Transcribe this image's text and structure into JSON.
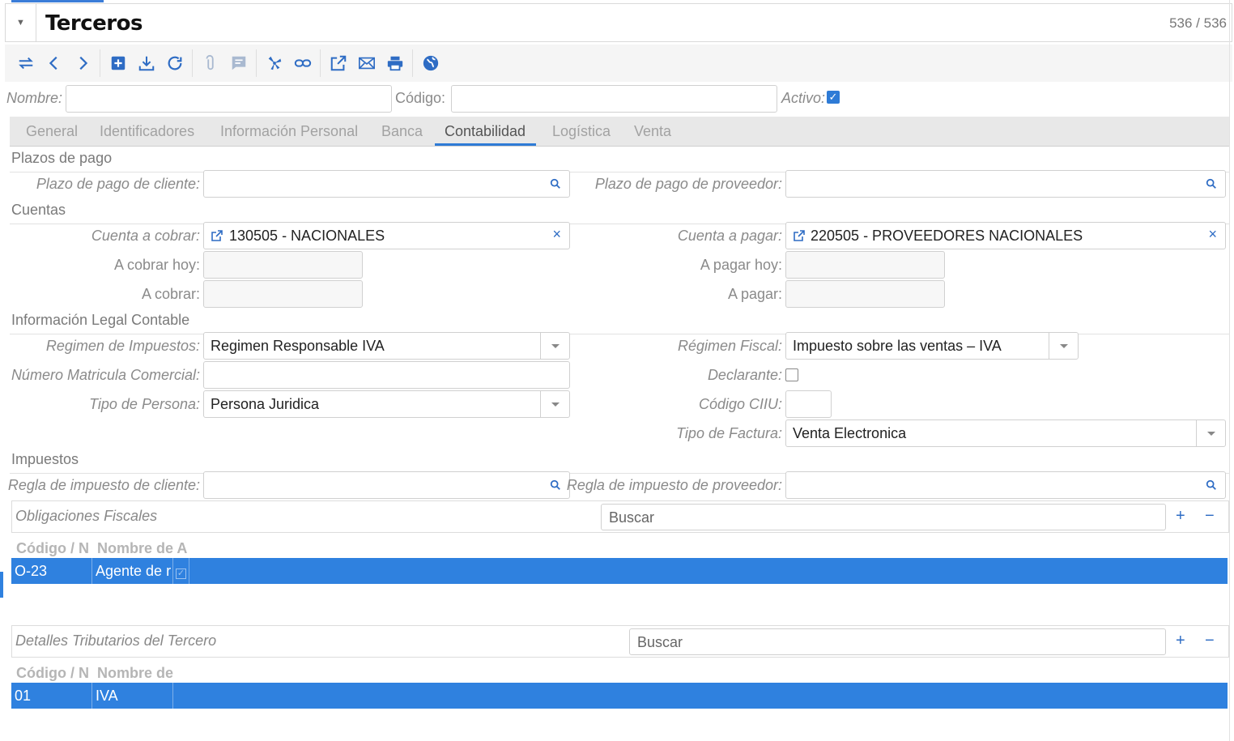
{
  "header": {
    "title": "Terceros",
    "record_count": "536 / 536"
  },
  "toolbar": {
    "icons": [
      "toggle-view-icon",
      "previous-icon",
      "next-icon",
      "new-record-icon",
      "save-icon",
      "reload-icon",
      "attachment-icon",
      "note-icon",
      "action-icon",
      "relate-icon",
      "open-icon",
      "email-icon",
      "print-icon",
      "web-icon"
    ]
  },
  "search": {
    "nombre_label": "Nombre:",
    "codigo_label": "Código:",
    "activo_label": "Activo:"
  },
  "tabs": [
    "General",
    "Identificadores",
    "Información Personal",
    "Banca",
    "Contabilidad",
    "Logística",
    "Venta"
  ],
  "active_tab": "Contabilidad",
  "plazos": {
    "title": "Plazos de pago",
    "cliente_label": "Plazo de pago de cliente:",
    "proveedor_label": "Plazo de pago de proveedor:"
  },
  "cuentas": {
    "title": "Cuentas",
    "cobrar_label": "Cuenta a cobrar:",
    "cobrar_value": "130505 - NACIONALES",
    "pagar_label": "Cuenta a pagar:",
    "pagar_value": "220505 - PROVEEDORES NACIONALES",
    "cobrar_hoy_label": "A cobrar hoy:",
    "pagar_hoy_label": "A pagar hoy:",
    "a_cobrar_label": "A cobrar:",
    "a_pagar_label": "A pagar:"
  },
  "legal": {
    "title": "Información Legal Contable",
    "regimen_impuestos_label": "Regimen de Impuestos:",
    "regimen_impuestos_value": "Regimen Responsable IVA",
    "regimen_fiscal_label": "Régimen Fiscal:",
    "regimen_fiscal_value": "Impuesto sobre las ventas – IVA",
    "matricula_label": "Número Matricula Comercial:",
    "declarante_label": "Declarante:",
    "tipo_persona_label": "Tipo de Persona:",
    "tipo_persona_value": "Persona Juridica",
    "ciiu_label": "Código CIIU:",
    "tipo_factura_label": "Tipo de Factura:",
    "tipo_factura_value": "Venta Electronica"
  },
  "impuestos": {
    "title": "Impuestos",
    "cliente_label": "Regla de impuesto de cliente:",
    "proveedor_label": "Regla de impuesto de proveedor:"
  },
  "obligaciones": {
    "title": "Obligaciones Fiscales",
    "search_placeholder": "Buscar",
    "plus": "+",
    "minus": "−",
    "columns": [
      "Código / N",
      "Nombre de A"
    ],
    "rows": [
      {
        "codigo": "O-23",
        "nombre": "Agente de r"
      }
    ]
  },
  "detalles": {
    "title": "Detalles Tributarios del Tercero",
    "search_placeholder": "Buscar",
    "plus": "+",
    "minus": "−",
    "columns": [
      "Código / N",
      "Nombre de"
    ],
    "rows": [
      {
        "codigo": "01",
        "nombre": "IVA"
      }
    ]
  },
  "colors": {
    "accent": "#2e7bd6",
    "selected_row": "#2f81df"
  }
}
